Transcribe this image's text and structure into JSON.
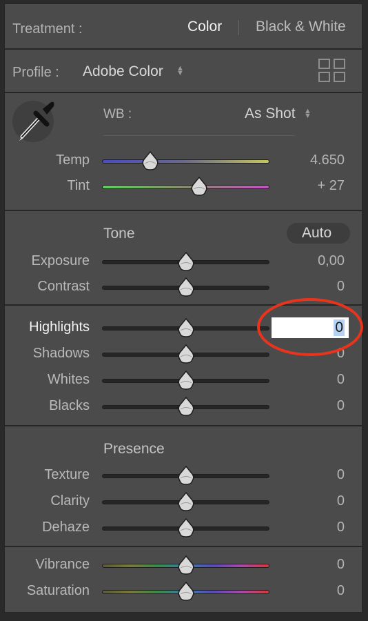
{
  "treatment": {
    "label": "Treatment :",
    "options": [
      "Color",
      "Black & White"
    ],
    "selected": "Color"
  },
  "profile": {
    "label": "Profile :",
    "value": "Adobe Color"
  },
  "wb": {
    "label": "WB :",
    "value": "As Shot"
  },
  "sliders_wb": [
    {
      "id": "temp",
      "label": "Temp",
      "value": "4.650",
      "level": 0.29
    },
    {
      "id": "tint",
      "label": "Tint",
      "value": "+ 27",
      "level": 0.58
    }
  ],
  "tone": {
    "title": "Tone",
    "auto_label": "Auto"
  },
  "sliders_tone": [
    {
      "id": "exposure",
      "label": "Exposure",
      "value": "0,00",
      "level": 0.5
    },
    {
      "id": "contrast",
      "label": "Contrast",
      "value": "0",
      "level": 0.5
    }
  ],
  "sliders_light": [
    {
      "id": "highlights",
      "label": "Highlights",
      "value": "0",
      "level": 0.5,
      "editing": true
    },
    {
      "id": "shadows",
      "label": "Shadows",
      "value": "0",
      "level": 0.5
    },
    {
      "id": "whites",
      "label": "Whites",
      "value": "0",
      "level": 0.5
    },
    {
      "id": "blacks",
      "label": "Blacks",
      "value": "0",
      "level": 0.5
    }
  ],
  "presence": {
    "title": "Presence"
  },
  "sliders_presence": [
    {
      "id": "texture",
      "label": "Texture",
      "value": "0",
      "level": 0.5
    },
    {
      "id": "clarity",
      "label": "Clarity",
      "value": "0",
      "level": 0.5
    },
    {
      "id": "dehaze",
      "label": "Dehaze",
      "value": "0",
      "level": 0.5
    }
  ],
  "sliders_color": [
    {
      "id": "vibrance",
      "label": "Vibrance",
      "value": "0",
      "level": 0.5
    },
    {
      "id": "saturation",
      "label": "Saturation",
      "value": "0",
      "level": 0.5
    }
  ],
  "colors": {
    "panel_bg": "#4b4b4b",
    "annotation_circle": "#e8341c",
    "temp_gradient": [
      "#4a4ac8",
      "#c8c85a"
    ],
    "tint_gradient": [
      "#5ad25a",
      "#c850c8"
    ]
  },
  "icons": {
    "eyedropper": "eyedropper-icon",
    "grid": "profile-browser-grid-icon"
  }
}
